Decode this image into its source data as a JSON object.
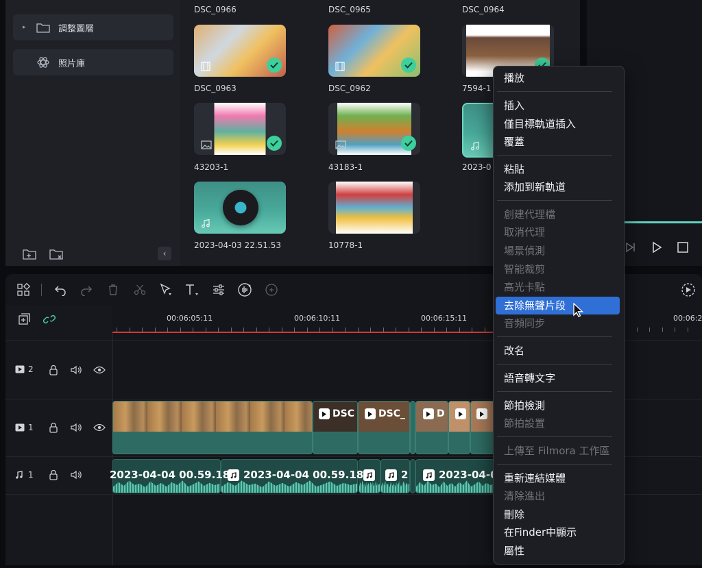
{
  "sidebar": {
    "items": [
      {
        "label": "調整圖層",
        "icon": "folder-icon"
      },
      {
        "label": "照片庫",
        "icon": "atom-icon"
      }
    ]
  },
  "media": {
    "row0_labels": [
      "DSC_0966",
      "DSC_0965",
      "DSC_0964"
    ],
    "items": [
      {
        "label": "DSC_0963",
        "type": "video",
        "checked": true
      },
      {
        "label": "DSC_0962",
        "type": "video",
        "checked": true
      },
      {
        "label": "7594-1",
        "type": "image",
        "checked": true
      },
      {
        "label": "43203-1",
        "type": "image",
        "checked": true
      },
      {
        "label": "43183-1",
        "type": "image",
        "checked": true
      },
      {
        "label": "2023-0",
        "type": "audio",
        "checked": false
      },
      {
        "label": "2023-04-03 22.51.53",
        "type": "audio",
        "checked": false
      },
      {
        "label": "10778-1",
        "type": "image",
        "checked": false
      }
    ]
  },
  "timeline": {
    "ruler": [
      "00:06:05:11",
      "00:06:10:11",
      "00:06:15:11",
      "00:06:2"
    ],
    "tracks": [
      {
        "id": "video-2",
        "label": "2"
      },
      {
        "id": "video-1",
        "label": "1"
      },
      {
        "id": "audio-1",
        "label": "1"
      }
    ],
    "video_clips": [
      "DSC",
      "DSC_",
      "D",
      ""
    ],
    "audio_clips": [
      "2023-04-04 00.59.18",
      "2023-04-04 00.59.18",
      "",
      "2",
      "2023-04-0"
    ]
  },
  "context_menu": {
    "items": [
      {
        "label": "播放",
        "enabled": true
      },
      {
        "label": "插入",
        "enabled": true
      },
      {
        "label": "僅目標軌道插入",
        "enabled": true
      },
      {
        "label": "覆蓋",
        "enabled": true
      },
      {
        "label": "粘貼",
        "enabled": true
      },
      {
        "label": "添加到新軌道",
        "enabled": true
      },
      {
        "label": "創建代理檔",
        "enabled": false
      },
      {
        "label": "取消代理",
        "enabled": false
      },
      {
        "label": "場景偵測",
        "enabled": false
      },
      {
        "label": "智能裁剪",
        "enabled": false
      },
      {
        "label": "高光卡點",
        "enabled": false
      },
      {
        "label": "去除無聲片段",
        "enabled": true,
        "highlighted": true
      },
      {
        "label": "音頻同步",
        "enabled": false
      },
      {
        "label": "改名",
        "enabled": true
      },
      {
        "label": "語音轉文字",
        "enabled": true
      },
      {
        "label": "節拍檢測",
        "enabled": true
      },
      {
        "label": "節拍設置",
        "enabled": false
      },
      {
        "label": "上傳至 Filmora 工作區",
        "enabled": false
      },
      {
        "label": "重新連結媒體",
        "enabled": true
      },
      {
        "label": "清除進出",
        "enabled": false
      },
      {
        "label": "刪除",
        "enabled": true
      },
      {
        "label": "在Finder中顯示",
        "enabled": true
      },
      {
        "label": "屬性",
        "enabled": true
      }
    ]
  },
  "colors": {
    "accent": "#3ecf9c",
    "highlight": "#2f6fd6",
    "playhead": "#d03a3a"
  }
}
